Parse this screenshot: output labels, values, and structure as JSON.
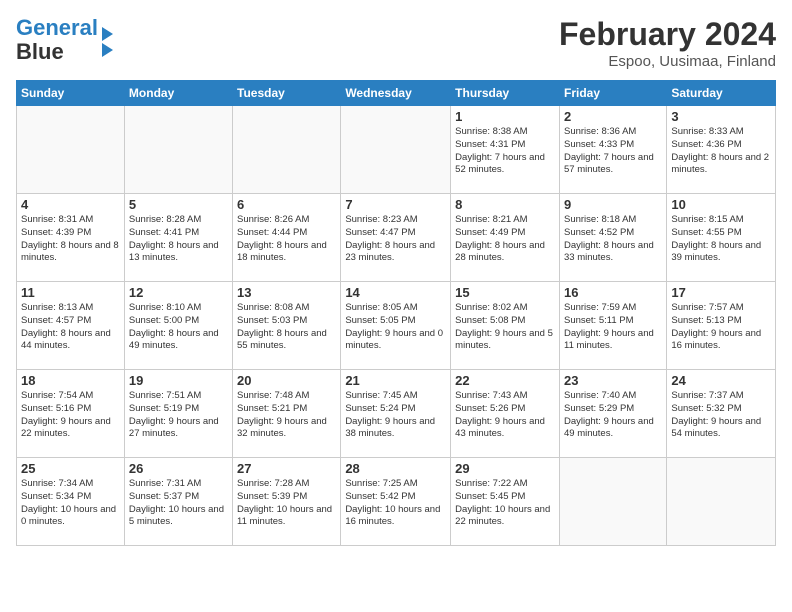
{
  "logo": {
    "line1": "General",
    "line2": "Blue"
  },
  "title": "February 2024",
  "location": "Espoo, Uusimaa, Finland",
  "days_of_week": [
    "Sunday",
    "Monday",
    "Tuesday",
    "Wednesday",
    "Thursday",
    "Friday",
    "Saturday"
  ],
  "weeks": [
    [
      {
        "day": "",
        "info": ""
      },
      {
        "day": "",
        "info": ""
      },
      {
        "day": "",
        "info": ""
      },
      {
        "day": "",
        "info": ""
      },
      {
        "day": "1",
        "info": "Sunrise: 8:38 AM\nSunset: 4:31 PM\nDaylight: 7 hours\nand 52 minutes."
      },
      {
        "day": "2",
        "info": "Sunrise: 8:36 AM\nSunset: 4:33 PM\nDaylight: 7 hours\nand 57 minutes."
      },
      {
        "day": "3",
        "info": "Sunrise: 8:33 AM\nSunset: 4:36 PM\nDaylight: 8 hours\nand 2 minutes."
      }
    ],
    [
      {
        "day": "4",
        "info": "Sunrise: 8:31 AM\nSunset: 4:39 PM\nDaylight: 8 hours\nand 8 minutes."
      },
      {
        "day": "5",
        "info": "Sunrise: 8:28 AM\nSunset: 4:41 PM\nDaylight: 8 hours\nand 13 minutes."
      },
      {
        "day": "6",
        "info": "Sunrise: 8:26 AM\nSunset: 4:44 PM\nDaylight: 8 hours\nand 18 minutes."
      },
      {
        "day": "7",
        "info": "Sunrise: 8:23 AM\nSunset: 4:47 PM\nDaylight: 8 hours\nand 23 minutes."
      },
      {
        "day": "8",
        "info": "Sunrise: 8:21 AM\nSunset: 4:49 PM\nDaylight: 8 hours\nand 28 minutes."
      },
      {
        "day": "9",
        "info": "Sunrise: 8:18 AM\nSunset: 4:52 PM\nDaylight: 8 hours\nand 33 minutes."
      },
      {
        "day": "10",
        "info": "Sunrise: 8:15 AM\nSunset: 4:55 PM\nDaylight: 8 hours\nand 39 minutes."
      }
    ],
    [
      {
        "day": "11",
        "info": "Sunrise: 8:13 AM\nSunset: 4:57 PM\nDaylight: 8 hours\nand 44 minutes."
      },
      {
        "day": "12",
        "info": "Sunrise: 8:10 AM\nSunset: 5:00 PM\nDaylight: 8 hours\nand 49 minutes."
      },
      {
        "day": "13",
        "info": "Sunrise: 8:08 AM\nSunset: 5:03 PM\nDaylight: 8 hours\nand 55 minutes."
      },
      {
        "day": "14",
        "info": "Sunrise: 8:05 AM\nSunset: 5:05 PM\nDaylight: 9 hours\nand 0 minutes."
      },
      {
        "day": "15",
        "info": "Sunrise: 8:02 AM\nSunset: 5:08 PM\nDaylight: 9 hours\nand 5 minutes."
      },
      {
        "day": "16",
        "info": "Sunrise: 7:59 AM\nSunset: 5:11 PM\nDaylight: 9 hours\nand 11 minutes."
      },
      {
        "day": "17",
        "info": "Sunrise: 7:57 AM\nSunset: 5:13 PM\nDaylight: 9 hours\nand 16 minutes."
      }
    ],
    [
      {
        "day": "18",
        "info": "Sunrise: 7:54 AM\nSunset: 5:16 PM\nDaylight: 9 hours\nand 22 minutes."
      },
      {
        "day": "19",
        "info": "Sunrise: 7:51 AM\nSunset: 5:19 PM\nDaylight: 9 hours\nand 27 minutes."
      },
      {
        "day": "20",
        "info": "Sunrise: 7:48 AM\nSunset: 5:21 PM\nDaylight: 9 hours\nand 32 minutes."
      },
      {
        "day": "21",
        "info": "Sunrise: 7:45 AM\nSunset: 5:24 PM\nDaylight: 9 hours\nand 38 minutes."
      },
      {
        "day": "22",
        "info": "Sunrise: 7:43 AM\nSunset: 5:26 PM\nDaylight: 9 hours\nand 43 minutes."
      },
      {
        "day": "23",
        "info": "Sunrise: 7:40 AM\nSunset: 5:29 PM\nDaylight: 9 hours\nand 49 minutes."
      },
      {
        "day": "24",
        "info": "Sunrise: 7:37 AM\nSunset: 5:32 PM\nDaylight: 9 hours\nand 54 minutes."
      }
    ],
    [
      {
        "day": "25",
        "info": "Sunrise: 7:34 AM\nSunset: 5:34 PM\nDaylight: 10 hours\nand 0 minutes."
      },
      {
        "day": "26",
        "info": "Sunrise: 7:31 AM\nSunset: 5:37 PM\nDaylight: 10 hours\nand 5 minutes."
      },
      {
        "day": "27",
        "info": "Sunrise: 7:28 AM\nSunset: 5:39 PM\nDaylight: 10 hours\nand 11 minutes."
      },
      {
        "day": "28",
        "info": "Sunrise: 7:25 AM\nSunset: 5:42 PM\nDaylight: 10 hours\nand 16 minutes."
      },
      {
        "day": "29",
        "info": "Sunrise: 7:22 AM\nSunset: 5:45 PM\nDaylight: 10 hours\nand 22 minutes."
      },
      {
        "day": "",
        "info": ""
      },
      {
        "day": "",
        "info": ""
      }
    ]
  ]
}
